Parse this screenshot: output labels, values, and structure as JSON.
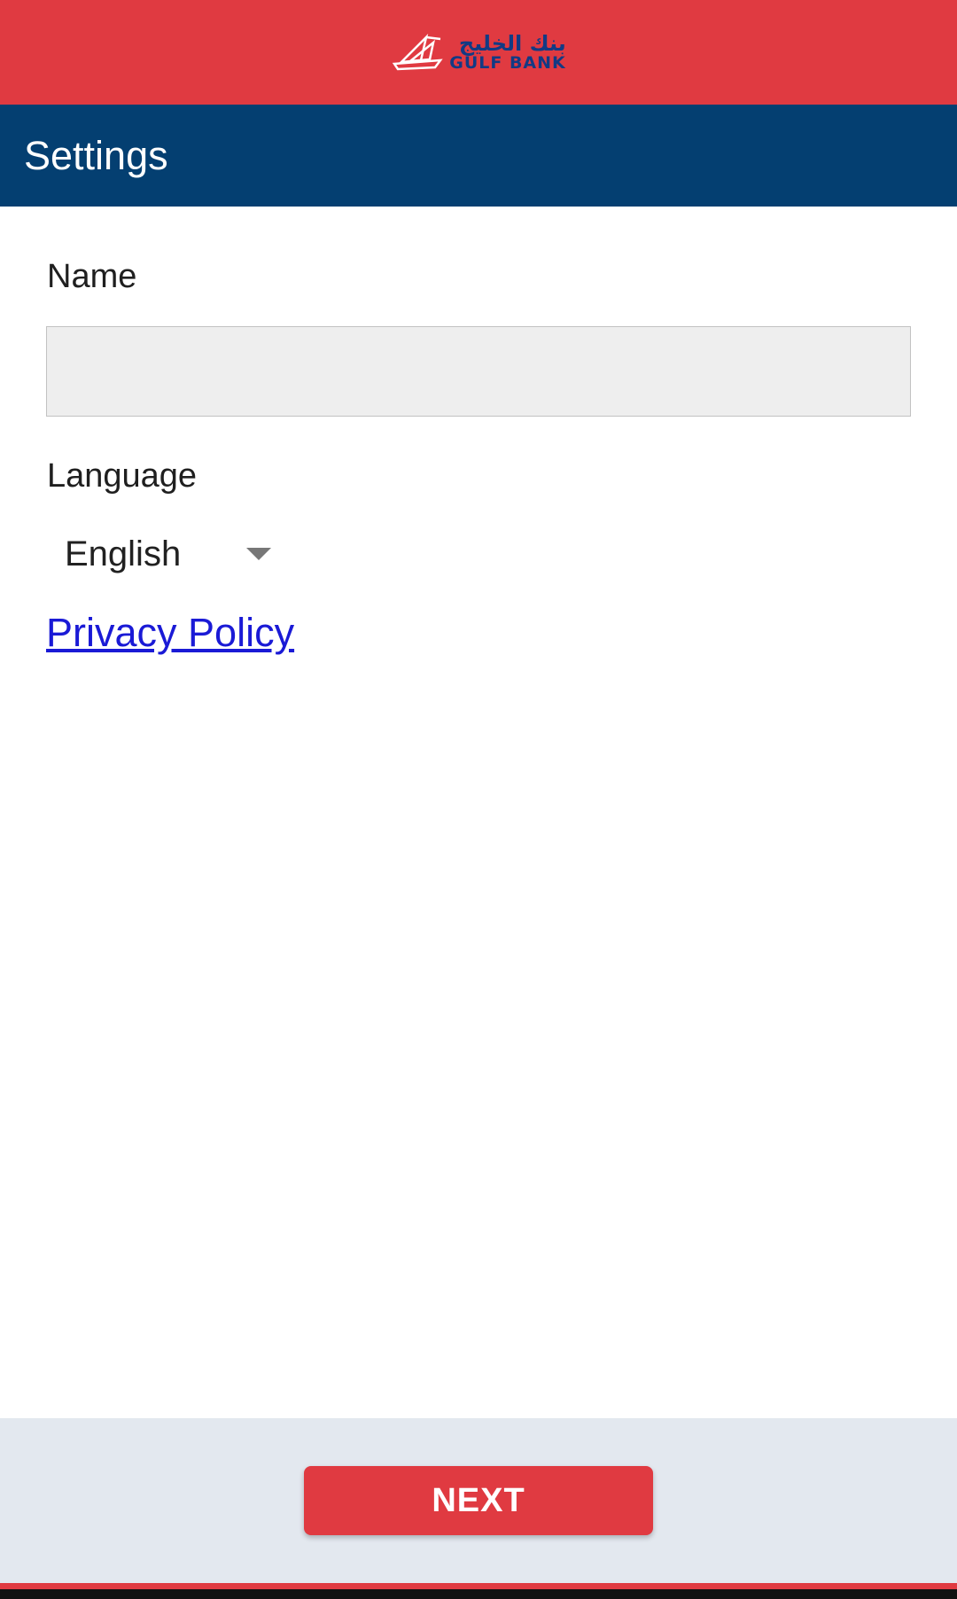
{
  "brand": {
    "name_ar": "بنك الخليج",
    "name_en": "GULF BANK",
    "logo_icon": "dhow-sail-logo-icon",
    "bar_color": "#e03a41",
    "text_color": "#123a84"
  },
  "header": {
    "title": "Settings",
    "bar_color": "#043f71"
  },
  "form": {
    "name_label": "Name",
    "name_value": "",
    "name_placeholder": "",
    "language_label": "Language",
    "language_selected": "English",
    "dropdown_icon": "caret-down-icon"
  },
  "links": {
    "privacy_policy": "Privacy Policy"
  },
  "footer": {
    "next_label": "NEXT",
    "button_color": "#e03a41",
    "background_color": "#e3e8ef"
  }
}
